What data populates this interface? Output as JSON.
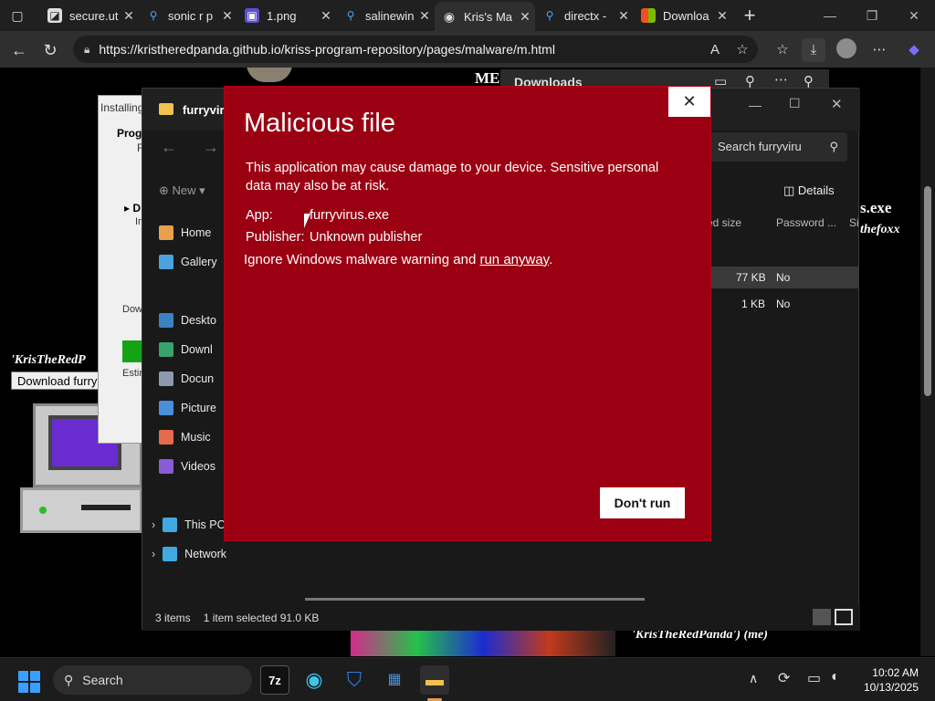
{
  "browser": {
    "tabs": [
      {
        "label": "secure.ut",
        "icon": "document-icon"
      },
      {
        "label": "sonic r p",
        "icon": "search-icon"
      },
      {
        "label": "1.png",
        "icon": "image-icon"
      },
      {
        "label": "salinewin",
        "icon": "search-icon"
      },
      {
        "label": "Kris's Ma",
        "icon": "globe-icon"
      },
      {
        "label": "directx -",
        "icon": "search-icon"
      },
      {
        "label": "Downloa",
        "icon": "windows-logo-icon"
      }
    ],
    "url": "https://kristheredpanda.github.io/kriss-program-repository/pages/malware/m.html"
  },
  "downloads_panel": {
    "title": "Downloads"
  },
  "explorer": {
    "title": "furryviru",
    "search_placeholder": "Search furryviru",
    "new_label": "New",
    "details_label": "Details",
    "columns": [
      "ed size",
      "Password ...",
      "Si"
    ],
    "rows": [
      {
        "size": "77 KB",
        "password": "No"
      },
      {
        "size": "1 KB",
        "password": "No"
      }
    ],
    "sidebar": [
      {
        "label": "Home",
        "icon": "home-icon",
        "color": "#e8a04c"
      },
      {
        "label": "Gallery",
        "icon": "gallery-icon",
        "color": "#4aa3df"
      },
      {
        "label": "Deskto",
        "icon": "desktop-icon",
        "color": "#3b82c4"
      },
      {
        "label": "Downl",
        "icon": "download-icon",
        "color": "#38a36a"
      },
      {
        "label": "Docun",
        "icon": "documents-icon",
        "color": "#8d99ae"
      },
      {
        "label": "Picture",
        "icon": "pictures-icon",
        "color": "#4a90d9"
      },
      {
        "label": "Music",
        "icon": "music-icon",
        "color": "#e86a4c"
      },
      {
        "label": "Videos",
        "icon": "videos-icon",
        "color": "#8a5bd6"
      },
      {
        "label": "This PC",
        "icon": "computer-icon",
        "color": "#3fa9e0"
      },
      {
        "label": "Network",
        "icon": "network-icon",
        "color": "#3fa9e0"
      }
    ],
    "status": {
      "items": "3 items",
      "selected": "1 item selected  91.0 KB"
    }
  },
  "installer": {
    "title": "Installing",
    "lines": [
      "Prog",
      "F",
      "D",
      "In",
      "Down",
      "Estim"
    ]
  },
  "dialog": {
    "title": "Malicious file",
    "body": "This application may cause damage to your device. Sensitive personal data may also be at risk.",
    "app_label": "App:",
    "app_value": "furryvirus.exe",
    "publisher_label": "Publisher:",
    "publisher_value": "Unknown publisher",
    "ignore_prefix": "Ignore Windows malware warning and ",
    "ignore_link": "run anyway",
    "ignore_suffix": ".",
    "dont_run_label": "Don't run",
    "bg_color": "#9a0012"
  },
  "page": {
    "left_caption": "'KrisTheRedP",
    "left_button": "Download furry",
    "right_exe": "s.exe",
    "right_author": "thefoxx",
    "bottom_caption": "'KrisTheRedPanda') (me)",
    "header_fragment": "ME"
  },
  "taskbar": {
    "search_label": "Search",
    "time": "10:02 AM",
    "date": "10/13/2025"
  }
}
